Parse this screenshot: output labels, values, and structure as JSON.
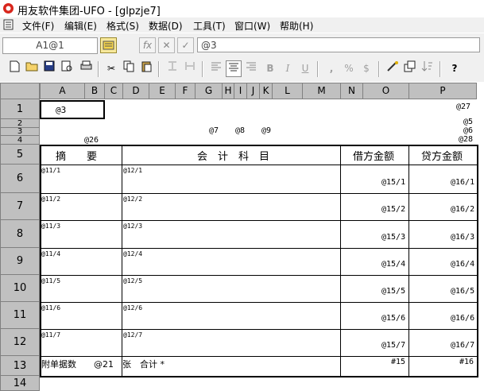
{
  "window": {
    "title": "用友软件集团-UFO - [glpzje7]"
  },
  "menu": [
    {
      "label": "文件(F)"
    },
    {
      "label": "编辑(E)"
    },
    {
      "label": "格式(S)"
    },
    {
      "label": "数据(D)"
    },
    {
      "label": "工具(T)"
    },
    {
      "label": "窗口(W)"
    },
    {
      "label": "帮助(H)"
    }
  ],
  "formula_bar": {
    "cell_ref": "A1@1",
    "fx": "fx",
    "cancel": "✕",
    "confirm": "✓",
    "content": "@3"
  },
  "toolbar": {
    "cut": "✂",
    "bold": "B",
    "italic": "I",
    "underline": "U",
    "thousands": ",",
    "percent": "%",
    "currency": "$",
    "help": "?"
  },
  "columns": [
    "A",
    "B",
    "C",
    "D",
    "E",
    "F",
    "G",
    "H",
    "I",
    "J",
    "K",
    "L",
    "M",
    "N",
    "O",
    "P"
  ],
  "rows": [
    "1",
    "2",
    "3",
    "4",
    "5",
    "6",
    "7",
    "8",
    "9",
    "10",
    "11",
    "12",
    "13",
    "14"
  ],
  "sheet": {
    "a1": "@3",
    "p1": "@27",
    "p2": "@5",
    "p3": "@6",
    "p4": "@28",
    "b4": "@26",
    "g3": "@7",
    "h3": "@8",
    "j3": "@9",
    "headers": {
      "summary": "摘　　要",
      "account": "会　计　科　目",
      "debit": "借方金额",
      "credit": "贷方金额"
    },
    "entries": [
      {
        "summary": "@11/1",
        "account": "@12/1",
        "debit": "@15/1",
        "credit": "@16/1"
      },
      {
        "summary": "@11/2",
        "account": "@12/2",
        "debit": "@15/2",
        "credit": "@16/2"
      },
      {
        "summary": "@11/3",
        "account": "@12/3",
        "debit": "@15/3",
        "credit": "@16/3"
      },
      {
        "summary": "@11/4",
        "account": "@12/4",
        "debit": "@15/4",
        "credit": "@16/4"
      },
      {
        "summary": "@11/5",
        "account": "@12/5",
        "debit": "@15/5",
        "credit": "@16/5"
      },
      {
        "summary": "@11/6",
        "account": "@12/6",
        "debit": "@15/6",
        "credit": "@16/6"
      },
      {
        "summary": "@11/7",
        "account": "@12/7",
        "debit": "@15/7",
        "credit": "@16/7"
      }
    ],
    "footer": {
      "attach": "附单据数　　@21　张　合计 *",
      "debit_total": "#15",
      "credit_total": "#16"
    }
  }
}
